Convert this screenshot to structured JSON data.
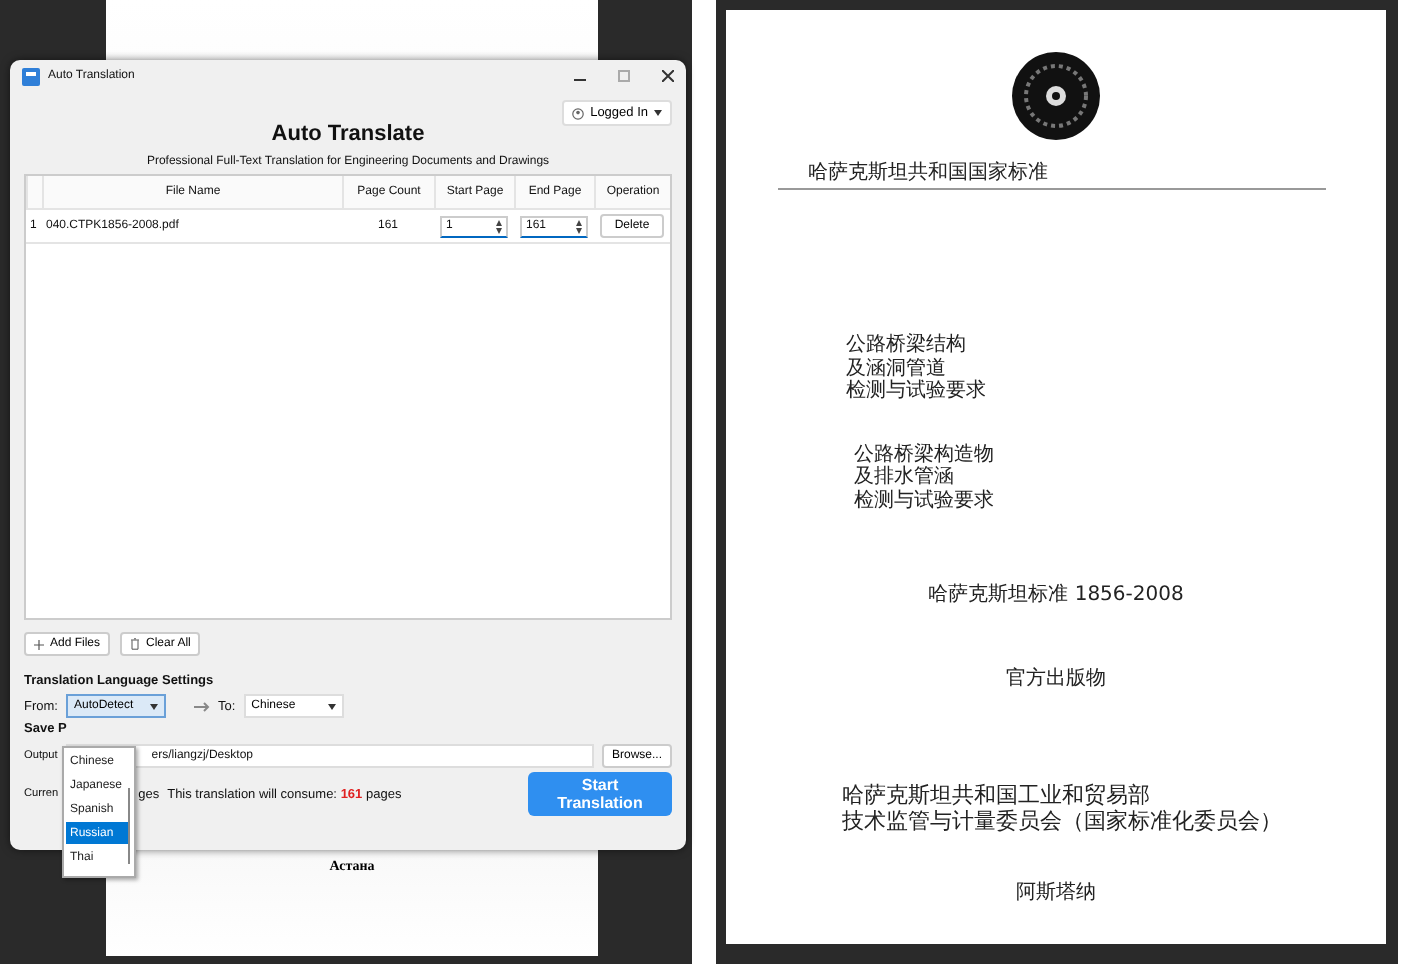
{
  "left_document": {
    "footer_title": "Астана"
  },
  "window": {
    "title": "Auto Translation",
    "account": "Logged In"
  },
  "heading": "Auto Translate",
  "subtitle": "Professional Full-Text Translation for Engineering Documents and Drawings",
  "table": {
    "columns": [
      "File Name",
      "Page Count",
      "Start Page",
      "End Page",
      "Operation"
    ],
    "rows": [
      {
        "index": "1",
        "file_name": "040.CTPK1856-2008.pdf",
        "page_count": "161",
        "start_page": "1",
        "end_page": "161",
        "operation": "Delete"
      }
    ]
  },
  "file_buttons": [
    "Add Files",
    "Clear All"
  ],
  "language_settings": {
    "title": "Translation Language Settings",
    "from_label": "From:",
    "from_value": "AutoDetect",
    "to_label": "To:",
    "to_value": "Chinese",
    "from_options": [
      {
        "label": "Chinese",
        "selected": false
      },
      {
        "label": "Japanese",
        "selected": false
      },
      {
        "label": "Spanish",
        "selected": false
      },
      {
        "label": "Russian",
        "selected": true
      },
      {
        "label": "Thai",
        "selected": false
      }
    ]
  },
  "save_path": {
    "title": "Save P",
    "output_label": "Output",
    "output_value": "ers/liangzj/Desktop",
    "browse": "Browse..."
  },
  "status": {
    "prefix": "Curren",
    "middle": "ges",
    "consume_text": "This translation will consume:",
    "count": "161",
    "suffix": "pages"
  },
  "start_button": "Start Translation",
  "right_document": {
    "header": "哈萨克斯坦共和国国家标准",
    "title_blocks": [
      [
        "公路桥梁结构",
        "及涵洞管道",
        "检测与试验要求"
      ],
      [
        "公路桥梁构造物",
        "及排水管涵",
        "检测与试验要求"
      ]
    ],
    "standard_number": "哈萨克斯坦标准 1856-2008",
    "publication": "官方出版物",
    "ministry": [
      "哈萨克斯坦共和国工业和贸易部",
      "技术监管与计量委员会（国家标准化委员会）"
    ],
    "city": "阿斯塔纳"
  }
}
